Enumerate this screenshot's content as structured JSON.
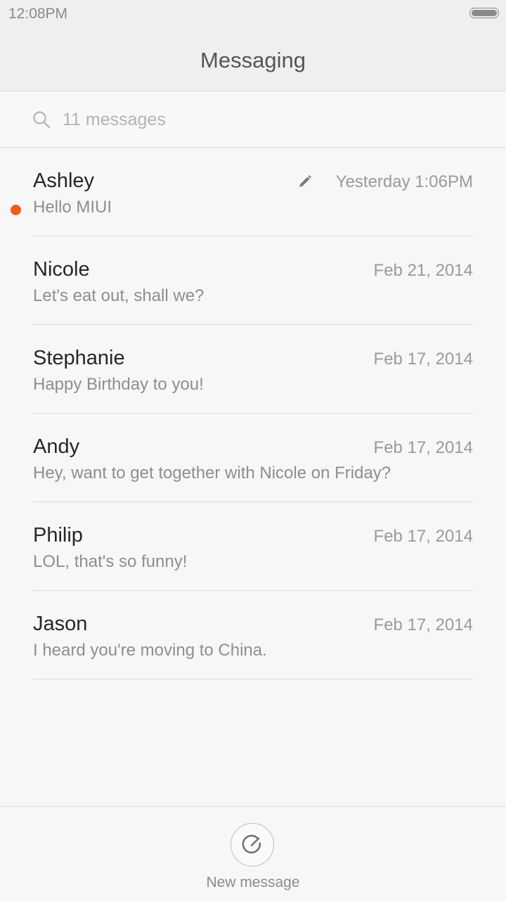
{
  "status_bar": {
    "time": "12:08PM",
    "battery_level": 1.0
  },
  "header": {
    "title": "Messaging"
  },
  "search": {
    "placeholder": "11 messages",
    "icon": "search-icon"
  },
  "conversations": [
    {
      "name": "Ashley",
      "preview": "Hello MIUI",
      "date": "Yesterday 1:06PM",
      "draft": true,
      "unread": false
    },
    {
      "name": "Nicole",
      "preview": "Let's eat out, shall we?",
      "date": "Feb 21, 2014",
      "draft": false,
      "unread": false
    },
    {
      "name": "Stephanie",
      "preview": "Happy Birthday to you!",
      "date": "Feb 17, 2014",
      "draft": false,
      "unread": true
    },
    {
      "name": "Andy",
      "preview": "Hey, want to get together with Nicole on Friday?",
      "date": "Feb 17, 2014",
      "draft": false,
      "unread": false
    },
    {
      "name": "Philip",
      "preview": "LOL, that's so funny!",
      "date": "Feb 17, 2014",
      "draft": false,
      "unread": false
    },
    {
      "name": "Jason",
      "preview": "I heard you're moving to China.",
      "date": "Feb 17, 2014",
      "draft": false,
      "unread": false
    }
  ],
  "footer": {
    "new_message_label": "New message",
    "icon": "compose-icon"
  },
  "colors": {
    "unread_accent": "#f25a1b"
  }
}
